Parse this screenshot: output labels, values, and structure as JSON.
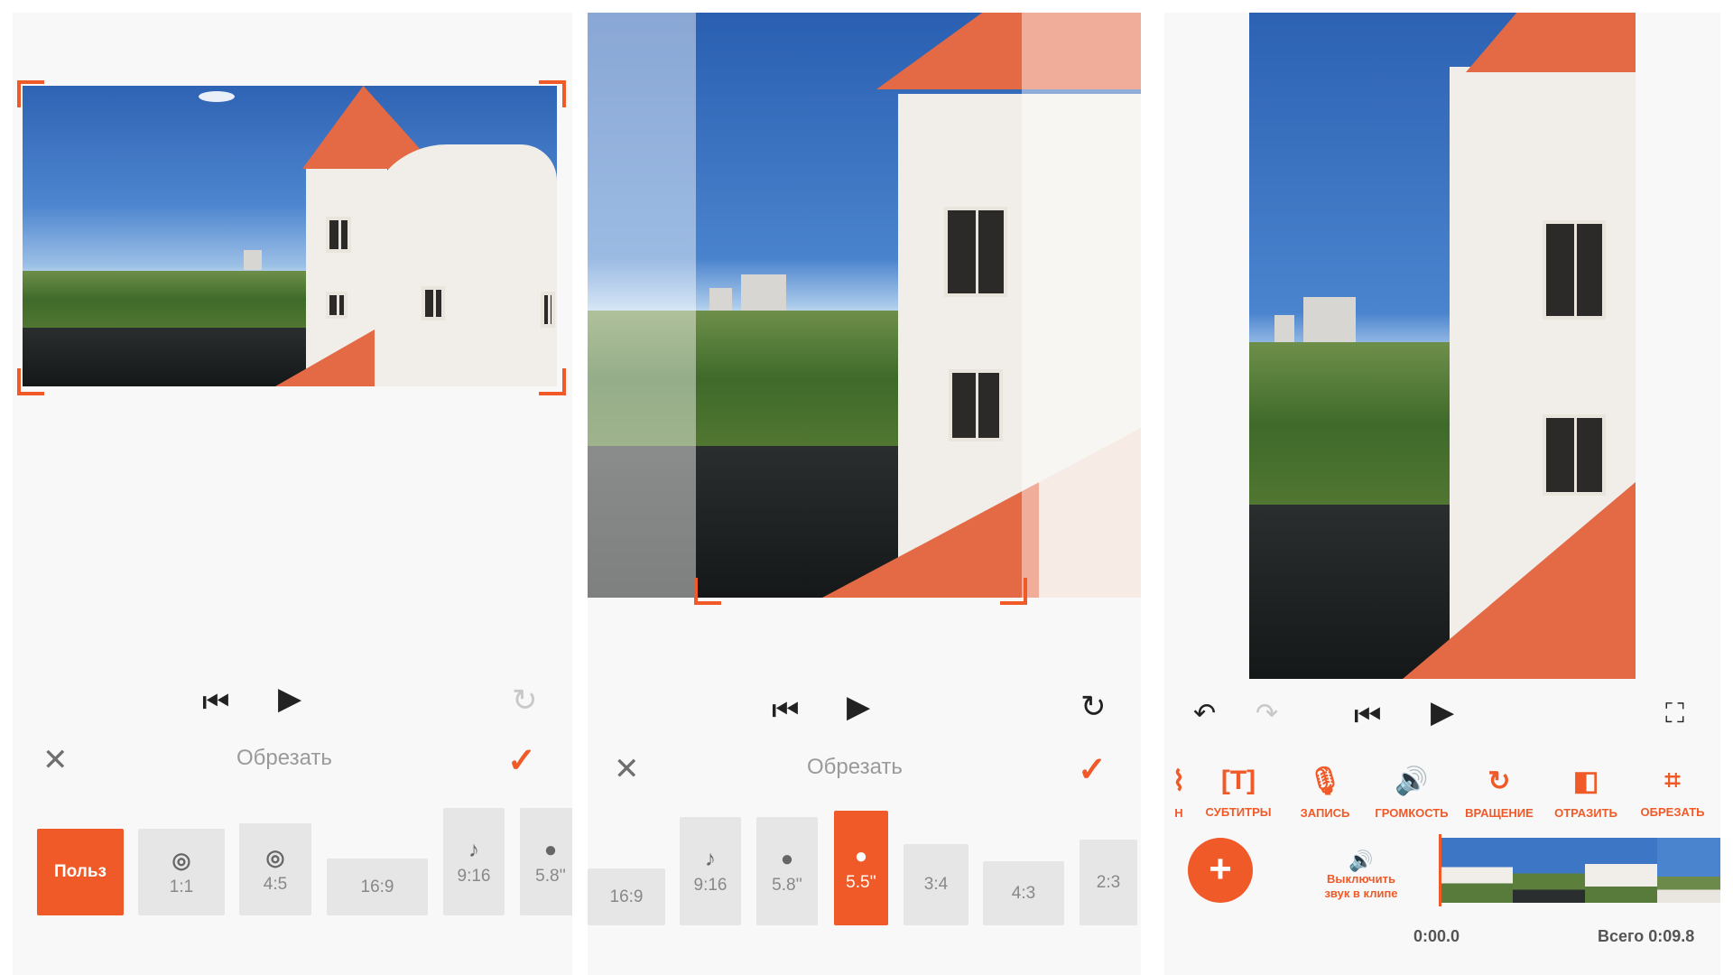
{
  "colors": {
    "accent": "#f05a28",
    "chip": "#e6e6e6",
    "panel_bg": "#f8f8f8"
  },
  "crop_panels": [
    {
      "title": "Обрезать",
      "icons": {
        "close": "close-icon",
        "confirm": "check-icon",
        "prev": "skip-back-icon",
        "play": "play-icon",
        "reset": "rotate-icon"
      },
      "chips": [
        {
          "label": "Польз",
          "icon": "",
          "active": true
        },
        {
          "label": "1:1",
          "icon": "instagram-icon"
        },
        {
          "label": "4:5",
          "icon": "instagram-icon"
        },
        {
          "label": "16:9",
          "icon": ""
        },
        {
          "label": "9:16",
          "icon": "tiktok-icon"
        },
        {
          "label": "5.8''",
          "icon": "apple-icon"
        }
      ]
    },
    {
      "title": "Обрезать",
      "icons": {
        "close": "close-icon",
        "confirm": "check-icon",
        "prev": "skip-back-icon",
        "play": "play-icon",
        "reset": "rotate-icon"
      },
      "chips": [
        {
          "label": "16:9",
          "icon": ""
        },
        {
          "label": "9:16",
          "icon": "tiktok-icon"
        },
        {
          "label": "5.8''",
          "icon": "apple-icon"
        },
        {
          "label": "5.5''",
          "icon": "apple-icon",
          "active": true
        },
        {
          "label": "3:4",
          "icon": ""
        },
        {
          "label": "4:3",
          "icon": ""
        },
        {
          "label": "2:3",
          "icon": ""
        }
      ]
    }
  ],
  "editor": {
    "icons": {
      "undo": "undo-icon",
      "redo": "redo-icon",
      "prev": "skip-back-icon",
      "play": "play-icon",
      "fullscreen": "fullscreen-icon"
    },
    "tools": [
      {
        "label": "Н",
        "icon": "cut-partial-icon"
      },
      {
        "label": "СУБТИТРЫ",
        "icon": "text-icon"
      },
      {
        "label": "ЗАПИСЬ",
        "icon": "microphone-icon"
      },
      {
        "label": "ГРОМКОСТЬ",
        "icon": "volume-icon"
      },
      {
        "label": "ВРАЩЕНИЕ",
        "icon": "rotate-icon"
      },
      {
        "label": "ОТРАЗИТЬ",
        "icon": "flip-icon"
      },
      {
        "label": "ОБРЕЗАТЬ",
        "icon": "crop-icon"
      }
    ],
    "add_label": "+",
    "mute_line1": "Выключить",
    "mute_line2": "звук в клипе",
    "current_time": "0:00.0",
    "total_time": "Всего 0:09.8"
  }
}
